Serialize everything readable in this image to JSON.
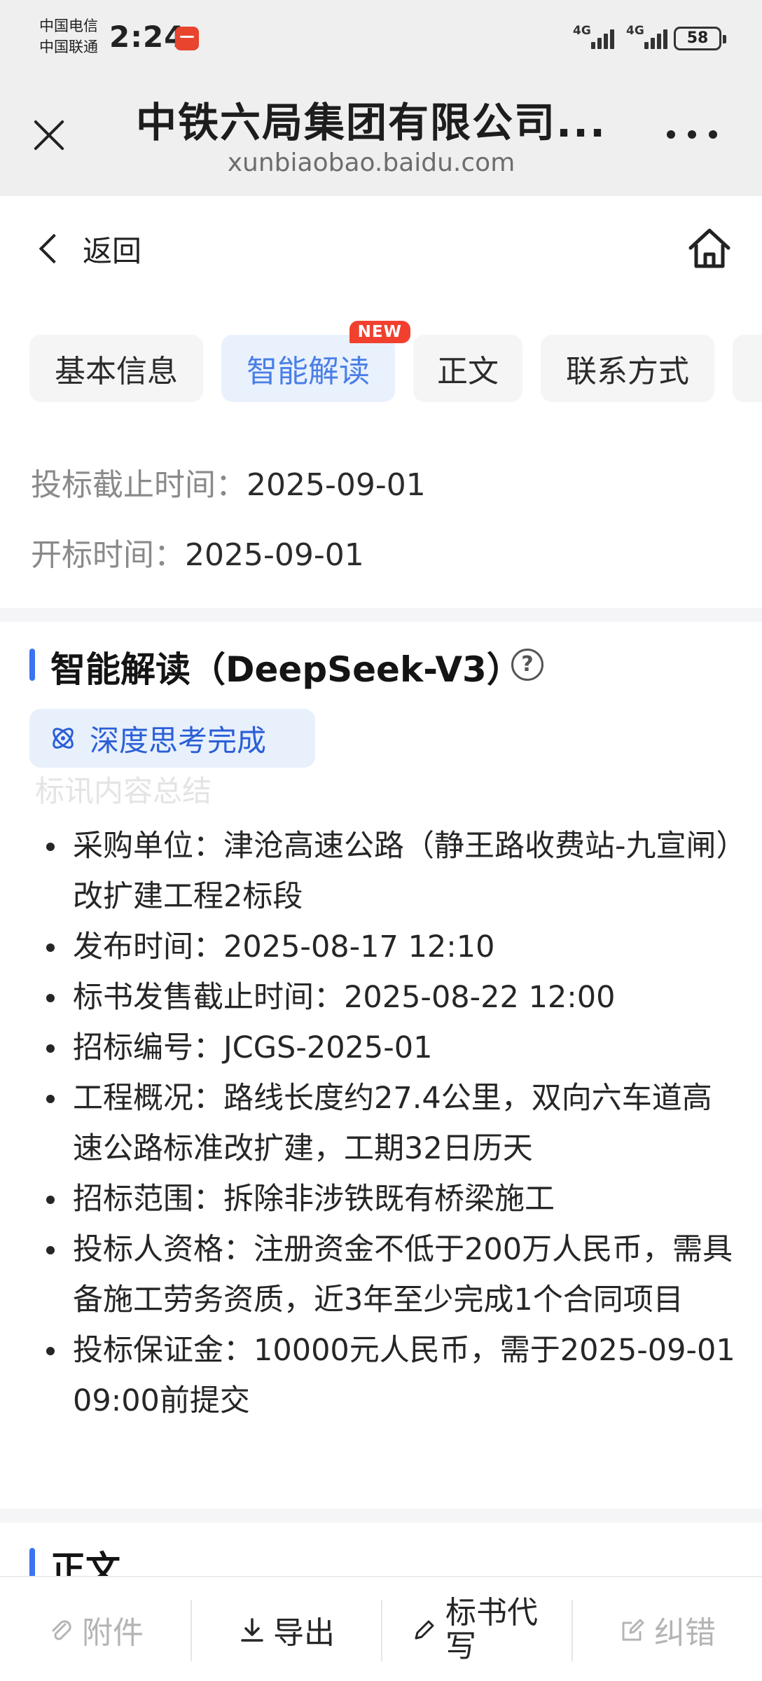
{
  "status_bar": {
    "carrier_1": "中国电信",
    "carrier_2": "中国联通",
    "time": "2:24",
    "signal_1": "4G",
    "signal_2": "4G",
    "battery": "58"
  },
  "browser": {
    "title": "中铁六局集团有限公司...",
    "url": "xunbiaobao.baidu.com"
  },
  "nav": {
    "back_label": "返回"
  },
  "tabs": [
    {
      "label": "基本信息",
      "active": false
    },
    {
      "label": "智能解读",
      "active": true,
      "badge": "NEW"
    },
    {
      "label": "正文",
      "active": false
    },
    {
      "label": "联系方式",
      "active": false
    }
  ],
  "dates": {
    "deadline_label": "投标截止时间：",
    "deadline_value": "2025-09-01",
    "opening_label": "开标时间：",
    "opening_value": "2025-09-01"
  },
  "ai_section": {
    "title": "智能解读（DeepSeek-V3）",
    "help_glyph": "?",
    "status_chip": "深度思考完成",
    "faded_heading": "标讯内容总结",
    "items": [
      "采购单位：津沧高速公路（静王路收费站-九宣闸）改扩建工程2标段",
      "发布时间：2025-08-17 12:10",
      "标书发售截止时间：2025-08-22 12:00",
      "招标编号：JCGS-2025-01",
      "工程概况：路线长度约27.4公里，双向六车道高速公路标准改扩建，工期32日历天",
      "招标范围：拆除非涉铁既有桥梁施工",
      "投标人资格：注册资金不低于200万人民币，需具备施工劳务资质，近3年至少完成1个合同项目",
      "投标保证金：10000元人民币，需于2025-09-01 09:00前提交"
    ]
  },
  "body_section": {
    "title": "正文"
  },
  "toolbar": {
    "attachment": "附件",
    "export": "导出",
    "ghostwrite": "标书代写",
    "report_error": "纠错"
  },
  "colors": {
    "accent": "#3b74f0",
    "tab_active_text": "#4a7fe6",
    "badge": "#f2402f",
    "chip_text": "#2a5fd6"
  }
}
